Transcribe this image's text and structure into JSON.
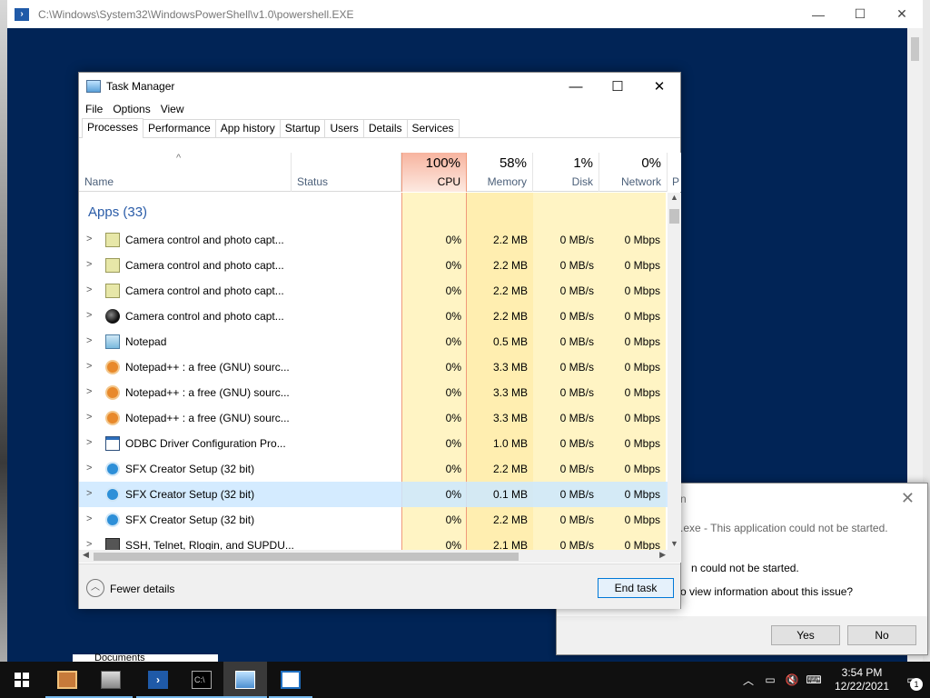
{
  "powershell": {
    "title": "C:\\Windows\\System32\\WindowsPowerShell\\v1.0\\powershell.EXE",
    "minimize": "—",
    "maximize": "☐",
    "close": "✕"
  },
  "error_dialog": {
    "title_fragment": "n",
    "close": "✕",
    "line1": ".exe - This application could not be started.",
    "line2": "n could not be started.",
    "line3": "o view information about this issue?",
    "yes_label": "Yes",
    "no_label": "No"
  },
  "explorer_peek": {
    "text": "Documents"
  },
  "task_manager": {
    "title": "Task Manager",
    "minimize": "—",
    "maximize": "☐",
    "close": "✕",
    "menu": [
      "File",
      "Options",
      "View"
    ],
    "tabs": [
      "Processes",
      "Performance",
      "App history",
      "Startup",
      "Users",
      "Details",
      "Services"
    ],
    "active_tab": "Processes",
    "columns": {
      "name": "Name",
      "status": "Status",
      "cpu_pct": "100%",
      "cpu": "CPU",
      "mem_pct": "58%",
      "mem": "Memory",
      "disk_pct": "1%",
      "disk": "Disk",
      "net_pct": "0%",
      "net": "Network",
      "power": "P"
    },
    "group_label": "Apps (33)",
    "rows": [
      {
        "name": "Camera control and photo capt...",
        "icon": "camera-app-icon",
        "cpu": "0%",
        "mem": "2.2 MB",
        "disk": "0 MB/s",
        "net": "0 Mbps"
      },
      {
        "name": "Camera control and photo capt...",
        "icon": "camera-app-icon",
        "cpu": "0%",
        "mem": "2.2 MB",
        "disk": "0 MB/s",
        "net": "0 Mbps"
      },
      {
        "name": "Camera control and photo capt...",
        "icon": "camera-app-icon",
        "cpu": "0%",
        "mem": "2.2 MB",
        "disk": "0 MB/s",
        "net": "0 Mbps"
      },
      {
        "name": "Camera control and photo capt...",
        "icon": "camera-lens-icon",
        "cpu": "0%",
        "mem": "2.2 MB",
        "disk": "0 MB/s",
        "net": "0 Mbps"
      },
      {
        "name": "Notepad",
        "icon": "notepad-icon",
        "cpu": "0%",
        "mem": "0.5 MB",
        "disk": "0 MB/s",
        "net": "0 Mbps"
      },
      {
        "name": "Notepad++ : a free (GNU) sourc...",
        "icon": "notepad-plus-plus-icon",
        "cpu": "0%",
        "mem": "3.3 MB",
        "disk": "0 MB/s",
        "net": "0 Mbps"
      },
      {
        "name": "Notepad++ : a free (GNU) sourc...",
        "icon": "notepad-plus-plus-icon",
        "cpu": "0%",
        "mem": "3.3 MB",
        "disk": "0 MB/s",
        "net": "0 Mbps"
      },
      {
        "name": "Notepad++ : a free (GNU) sourc...",
        "icon": "notepad-plus-plus-icon",
        "cpu": "0%",
        "mem": "3.3 MB",
        "disk": "0 MB/s",
        "net": "0 Mbps"
      },
      {
        "name": "ODBC Driver Configuration Pro...",
        "icon": "odbc-icon",
        "cpu": "0%",
        "mem": "1.0 MB",
        "disk": "0 MB/s",
        "net": "0 Mbps"
      },
      {
        "name": "SFX Creator Setup (32 bit)",
        "icon": "sfx-setup-icon",
        "cpu": "0%",
        "mem": "2.2 MB",
        "disk": "0 MB/s",
        "net": "0 Mbps"
      },
      {
        "name": "SFX Creator Setup (32 bit)",
        "icon": "sfx-setup-icon",
        "cpu": "0%",
        "mem": "0.1 MB",
        "disk": "0 MB/s",
        "net": "0 Mbps",
        "selected": true
      },
      {
        "name": "SFX Creator Setup (32 bit)",
        "icon": "sfx-setup-icon",
        "cpu": "0%",
        "mem": "2.2 MB",
        "disk": "0 MB/s",
        "net": "0 Mbps"
      },
      {
        "name": "SSH, Telnet, Rlogin, and SUPDU...",
        "icon": "ssh-client-icon",
        "cpu": "0%",
        "mem": "2.1 MB",
        "disk": "0 MB/s",
        "net": "0 Mbps"
      }
    ],
    "fewer_details": "Fewer details",
    "end_task": "End task"
  },
  "taskbar": {
    "apps": [
      "installer-icon",
      "tools-icon",
      "powershell-icon",
      "cmd-icon",
      "task-manager-icon",
      "window-app-icon"
    ],
    "active_app": "task-manager-icon",
    "time": "3:54 PM",
    "date": "12/22/2021",
    "notification_count": "1"
  }
}
